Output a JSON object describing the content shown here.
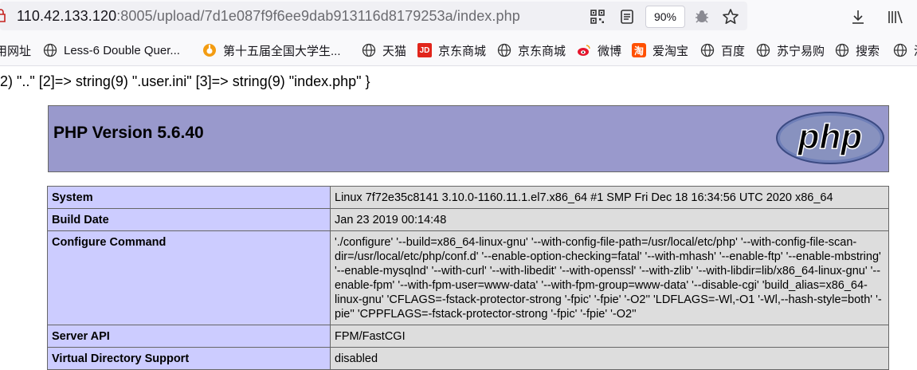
{
  "browser": {
    "url_host": "110.42.133.120",
    "url_rest": ":8005/upload/7d1e087f9f6ee9dab913116d8179253a/index.php",
    "zoom": "90%",
    "icons": [
      "qr-code-icon",
      "reader-view-icon",
      "bug-icon",
      "star-icon",
      "download-icon",
      "library-icon"
    ]
  },
  "bookmarks": [
    {
      "label": "用网址",
      "icon": "none"
    },
    {
      "label": "Less-6 Double Quer...",
      "icon": "globe-icon"
    },
    {
      "label": "第十五届全国大学生...",
      "icon": "orange-logo-icon"
    },
    {
      "label": "天猫",
      "icon": "globe-icon"
    },
    {
      "label": "京东商城",
      "icon": "jd-logo-icon"
    },
    {
      "label": "京东商城",
      "icon": "globe-icon"
    },
    {
      "label": "微博",
      "icon": "weibo-icon"
    },
    {
      "label": "爱淘宝",
      "icon": "taobao-icon"
    },
    {
      "label": "百度",
      "icon": "globe-icon"
    },
    {
      "label": "苏宁易购",
      "icon": "globe-icon"
    },
    {
      "label": "搜索",
      "icon": "globe-icon"
    },
    {
      "label": "淘",
      "icon": "globe-icon"
    }
  ],
  "dump_line": "2) \"..\" [2]=> string(9) \".user.ini\" [3]=> string(9) \"index.php\" }",
  "phpinfo": {
    "title": "PHP Version 5.6.40",
    "logo_text": "php",
    "rows": [
      {
        "key": "System",
        "value": "Linux 7f72e35c8141 3.10.0-1160.11.1.el7.x86_64 #1 SMP Fri Dec 18 16:34:56 UTC 2020 x86_64"
      },
      {
        "key": "Build Date",
        "value": "Jan 23 2019 00:14:48"
      },
      {
        "key": "Configure Command",
        "value": "'./configure' '--build=x86_64-linux-gnu' '--with-config-file-path=/usr/local/etc/php' '--with-config-file-scan-dir=/usr/local/etc/php/conf.d' '--enable-option-checking=fatal' '--with-mhash' '--enable-ftp' '--enable-mbstring' '--enable-mysqlnd' '--with-curl' '--with-libedit' '--with-openssl' '--with-zlib' '--with-libdir=lib/x86_64-linux-gnu' '--enable-fpm' '--with-fpm-user=www-data' '--with-fpm-group=www-data' '--disable-cgi' 'build_alias=x86_64-linux-gnu' 'CFLAGS=-fstack-protector-strong '-fpic' '-fpie' '-O2'' 'LDFLAGS=-Wl,-O1 '-Wl,--hash-style=both' '-pie'' 'CPPFLAGS=-fstack-protector-strong '-fpic' '-fpie' '-O2''"
      },
      {
        "key": "Server API",
        "value": "FPM/FastCGI"
      },
      {
        "key": "Virtual Directory Support",
        "value": "disabled"
      }
    ]
  }
}
